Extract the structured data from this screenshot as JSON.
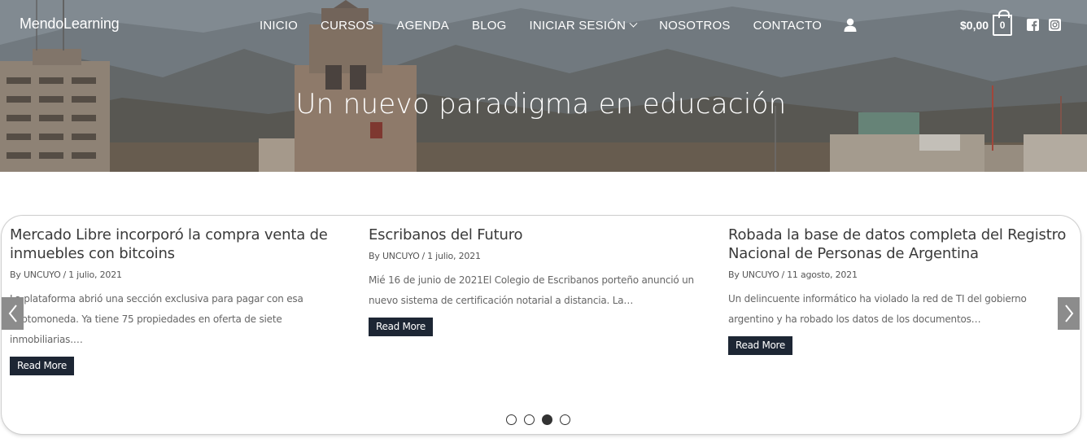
{
  "brand": "MendoLearning",
  "nav": {
    "items": [
      "INICIO",
      "CURSOS",
      "AGENDA",
      "BLOG",
      "INICIAR SESIÓN",
      "NOSOTROS",
      "CONTACTO"
    ],
    "cart_total": "$0,00",
    "cart_count": "0"
  },
  "icons": {
    "user": "user-icon",
    "cart": "cart-icon",
    "facebook": "facebook-icon",
    "instagram": "instagram-icon",
    "prev": "chevron-left-icon",
    "next": "chevron-right-icon"
  },
  "hero": {
    "title": "Un nuevo paradigma en educación"
  },
  "posts": [
    {
      "title": "Mercado Libre incorporó la compra venta de inmuebles con bitcoins",
      "author": "By UNCUYO",
      "date": "1 julio, 2021",
      "excerpt": "La plataforma abrió una sección exclusiva para pagar con esa criptomoneda. Ya tiene 75 propiedades en oferta de siete inmobiliarias.…",
      "read_more": "Read More"
    },
    {
      "title": "Escribanos del Futuro",
      "author": "By UNCUYO",
      "date": "1 julio, 2021",
      "excerpt": "Mié 16 de junio de 2021El Colegio de Escribanos porteño anunció un nuevo sistema de certificación notarial a distancia. La…",
      "read_more": "Read More"
    },
    {
      "title": "Robada la base de datos completa del Registro Nacional de Personas de Argentina",
      "author": "By UNCUYO",
      "date": "11 agosto, 2021",
      "excerpt": "Un delincuente informático ha violado la red de TI del gobierno argentino y ha robado los datos de los documentos…",
      "read_more": "Read More"
    }
  ],
  "slider": {
    "active_dot": 3,
    "dot_count": 4
  },
  "colors": {
    "button_bg": "#1d2634",
    "arrow_bg": "#8c8c8c",
    "text": "#3a3a3a"
  }
}
